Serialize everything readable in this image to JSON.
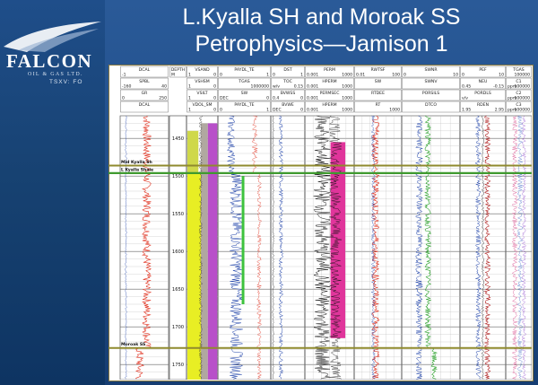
{
  "slide": {
    "title_line1": "L.Kyalla SH and Moroak SS",
    "title_line2": "Petrophysics—Jamison 1"
  },
  "logo": {
    "brand": "FALCON",
    "tagline": "OIL & GAS LTD.",
    "ticker": "TSXV: FO"
  },
  "colors": {
    "sidebar": "#1a4680",
    "background": "#22508c",
    "marker_line": "#8f8a2e",
    "marker_line_green": "#3f9a2f"
  },
  "chart_data": {
    "type": "well-log",
    "depth_axis": {
      "label": "DEPTH",
      "unit": "M",
      "range": [
        1420,
        1770
      ],
      "ticks": [
        1450,
        1500,
        1550,
        1600,
        1650,
        1700,
        1750
      ]
    },
    "formation_tops": [
      {
        "name": "Mid Kyalla Sh",
        "depth": 1486
      },
      {
        "name": "L Kyalla Shale",
        "depth": 1496
      },
      {
        "name": "Moroak SS",
        "depth": 1728
      }
    ],
    "tracks": [
      {
        "curves": [
          {
            "name": "DCAL",
            "scale": [
              "-1",
              ""
            ]
          },
          {
            "name": "SPBL",
            "scale": [
              "-160",
              "40"
            ]
          },
          {
            "name": "GR",
            "scale": [
              "0",
              "250"
            ]
          },
          {
            "name": "DCAL",
            "scale": [
              "",
              ""
            ]
          }
        ]
      },
      {
        "curves": [
          {
            "name": "DEPTH",
            "scale": [
              "M",
              ""
            ]
          }
        ]
      },
      {
        "curves": [
          {
            "name": "VSAND",
            "scale": [
              "1",
              "0"
            ]
          },
          {
            "name": "VSHSM",
            "scale": [
              "1",
              "0"
            ]
          },
          {
            "name": "VSILT",
            "scale": [
              "1",
              "0"
            ]
          },
          {
            "name": "VDOL_SM",
            "scale": [
              "1",
              "0"
            ]
          }
        ]
      },
      {
        "curves": [
          {
            "name": "PAYDL_TE",
            "scale": [
              "0",
              "1"
            ]
          },
          {
            "name": "TGAS",
            "scale": [
              "",
              "1000000"
            ]
          },
          {
            "name": "SW",
            "scale": [
              "DEC",
              "0"
            ]
          },
          {
            "name": "PAYDL_TE",
            "scale": [
              "0",
              "1"
            ]
          }
        ]
      },
      {
        "curves": [
          {
            "name": "DST",
            "scale": [
              "0",
              "1"
            ]
          },
          {
            "name": "TOC",
            "scale": [
              "w/v",
              "0.15"
            ]
          },
          {
            "name": "BVWSS",
            "scale": [
              "0.4",
              "0"
            ]
          },
          {
            "name": "BVWE",
            "scale": [
              "DEC",
              "0"
            ]
          }
        ]
      },
      {
        "curves": [
          {
            "name": "PERM",
            "scale": [
              "0.001",
              "1000"
            ]
          },
          {
            "name": "HPERM",
            "scale": [
              "0.001",
              "1000"
            ]
          },
          {
            "name": "PERMSEC",
            "scale": [
              "0.001",
              "1000"
            ]
          },
          {
            "name": "HPERM",
            "scale": [
              "0.001",
              "1000"
            ]
          }
        ]
      },
      {
        "curves": [
          {
            "name": "RWTSF",
            "scale": [
              "0.01",
              "100"
            ]
          },
          {
            "name": "SW",
            "scale": [
              "",
              ""
            ]
          },
          {
            "name": "RTDEE",
            "scale": [
              "",
              ""
            ]
          },
          {
            "name": "RT",
            "scale": [
              "",
              "1000"
            ]
          }
        ]
      },
      {
        "curves": [
          {
            "name": "SWNR",
            "scale": [
              "0",
              "10"
            ]
          },
          {
            "name": "SWNV",
            "scale": [
              "",
              ""
            ]
          },
          {
            "name": "PORSILS",
            "scale": [
              "",
              ""
            ]
          },
          {
            "name": "DTCO",
            "scale": [
              "",
              ""
            ]
          }
        ]
      },
      {
        "curves": [
          {
            "name": "PEF",
            "scale": [
              "0",
              "10"
            ]
          },
          {
            "name": "NEU",
            "scale": [
              "0.45",
              "-0.15"
            ]
          },
          {
            "name": "PORDLS",
            "scale": [
              "v/v",
              ""
            ]
          },
          {
            "name": "RDEN",
            "scale": [
              "1.95",
              "2.95"
            ]
          }
        ]
      },
      {
        "curves": [
          {
            "name": "TGAS",
            "scale": [
              "",
              "100000"
            ]
          },
          {
            "name": "C1",
            "scale": [
              "ppm",
              "100000"
            ]
          },
          {
            "name": "C2",
            "scale": [
              "ppm",
              "100000"
            ]
          },
          {
            "name": "C3",
            "scale": [
              "ppm",
              "100000"
            ]
          }
        ]
      }
    ]
  }
}
